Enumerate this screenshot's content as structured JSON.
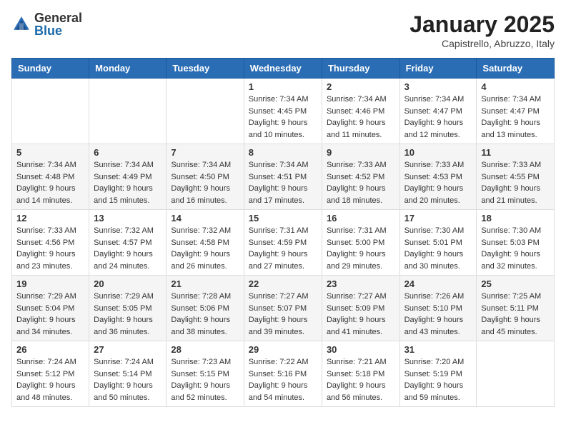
{
  "header": {
    "logo_general": "General",
    "logo_blue": "Blue",
    "month_title": "January 2025",
    "location": "Capistrello, Abruzzo, Italy"
  },
  "days_of_week": [
    "Sunday",
    "Monday",
    "Tuesday",
    "Wednesday",
    "Thursday",
    "Friday",
    "Saturday"
  ],
  "weeks": [
    [
      {
        "day": "",
        "info": ""
      },
      {
        "day": "",
        "info": ""
      },
      {
        "day": "",
        "info": ""
      },
      {
        "day": "1",
        "info": "Sunrise: 7:34 AM\nSunset: 4:45 PM\nDaylight: 9 hours\nand 10 minutes."
      },
      {
        "day": "2",
        "info": "Sunrise: 7:34 AM\nSunset: 4:46 PM\nDaylight: 9 hours\nand 11 minutes."
      },
      {
        "day": "3",
        "info": "Sunrise: 7:34 AM\nSunset: 4:47 PM\nDaylight: 9 hours\nand 12 minutes."
      },
      {
        "day": "4",
        "info": "Sunrise: 7:34 AM\nSunset: 4:47 PM\nDaylight: 9 hours\nand 13 minutes."
      }
    ],
    [
      {
        "day": "5",
        "info": "Sunrise: 7:34 AM\nSunset: 4:48 PM\nDaylight: 9 hours\nand 14 minutes."
      },
      {
        "day": "6",
        "info": "Sunrise: 7:34 AM\nSunset: 4:49 PM\nDaylight: 9 hours\nand 15 minutes."
      },
      {
        "day": "7",
        "info": "Sunrise: 7:34 AM\nSunset: 4:50 PM\nDaylight: 9 hours\nand 16 minutes."
      },
      {
        "day": "8",
        "info": "Sunrise: 7:34 AM\nSunset: 4:51 PM\nDaylight: 9 hours\nand 17 minutes."
      },
      {
        "day": "9",
        "info": "Sunrise: 7:33 AM\nSunset: 4:52 PM\nDaylight: 9 hours\nand 18 minutes."
      },
      {
        "day": "10",
        "info": "Sunrise: 7:33 AM\nSunset: 4:53 PM\nDaylight: 9 hours\nand 20 minutes."
      },
      {
        "day": "11",
        "info": "Sunrise: 7:33 AM\nSunset: 4:55 PM\nDaylight: 9 hours\nand 21 minutes."
      }
    ],
    [
      {
        "day": "12",
        "info": "Sunrise: 7:33 AM\nSunset: 4:56 PM\nDaylight: 9 hours\nand 23 minutes."
      },
      {
        "day": "13",
        "info": "Sunrise: 7:32 AM\nSunset: 4:57 PM\nDaylight: 9 hours\nand 24 minutes."
      },
      {
        "day": "14",
        "info": "Sunrise: 7:32 AM\nSunset: 4:58 PM\nDaylight: 9 hours\nand 26 minutes."
      },
      {
        "day": "15",
        "info": "Sunrise: 7:31 AM\nSunset: 4:59 PM\nDaylight: 9 hours\nand 27 minutes."
      },
      {
        "day": "16",
        "info": "Sunrise: 7:31 AM\nSunset: 5:00 PM\nDaylight: 9 hours\nand 29 minutes."
      },
      {
        "day": "17",
        "info": "Sunrise: 7:30 AM\nSunset: 5:01 PM\nDaylight: 9 hours\nand 30 minutes."
      },
      {
        "day": "18",
        "info": "Sunrise: 7:30 AM\nSunset: 5:03 PM\nDaylight: 9 hours\nand 32 minutes."
      }
    ],
    [
      {
        "day": "19",
        "info": "Sunrise: 7:29 AM\nSunset: 5:04 PM\nDaylight: 9 hours\nand 34 minutes."
      },
      {
        "day": "20",
        "info": "Sunrise: 7:29 AM\nSunset: 5:05 PM\nDaylight: 9 hours\nand 36 minutes."
      },
      {
        "day": "21",
        "info": "Sunrise: 7:28 AM\nSunset: 5:06 PM\nDaylight: 9 hours\nand 38 minutes."
      },
      {
        "day": "22",
        "info": "Sunrise: 7:27 AM\nSunset: 5:07 PM\nDaylight: 9 hours\nand 39 minutes."
      },
      {
        "day": "23",
        "info": "Sunrise: 7:27 AM\nSunset: 5:09 PM\nDaylight: 9 hours\nand 41 minutes."
      },
      {
        "day": "24",
        "info": "Sunrise: 7:26 AM\nSunset: 5:10 PM\nDaylight: 9 hours\nand 43 minutes."
      },
      {
        "day": "25",
        "info": "Sunrise: 7:25 AM\nSunset: 5:11 PM\nDaylight: 9 hours\nand 45 minutes."
      }
    ],
    [
      {
        "day": "26",
        "info": "Sunrise: 7:24 AM\nSunset: 5:12 PM\nDaylight: 9 hours\nand 48 minutes."
      },
      {
        "day": "27",
        "info": "Sunrise: 7:24 AM\nSunset: 5:14 PM\nDaylight: 9 hours\nand 50 minutes."
      },
      {
        "day": "28",
        "info": "Sunrise: 7:23 AM\nSunset: 5:15 PM\nDaylight: 9 hours\nand 52 minutes."
      },
      {
        "day": "29",
        "info": "Sunrise: 7:22 AM\nSunset: 5:16 PM\nDaylight: 9 hours\nand 54 minutes."
      },
      {
        "day": "30",
        "info": "Sunrise: 7:21 AM\nSunset: 5:18 PM\nDaylight: 9 hours\nand 56 minutes."
      },
      {
        "day": "31",
        "info": "Sunrise: 7:20 AM\nSunset: 5:19 PM\nDaylight: 9 hours\nand 59 minutes."
      },
      {
        "day": "",
        "info": ""
      }
    ]
  ]
}
